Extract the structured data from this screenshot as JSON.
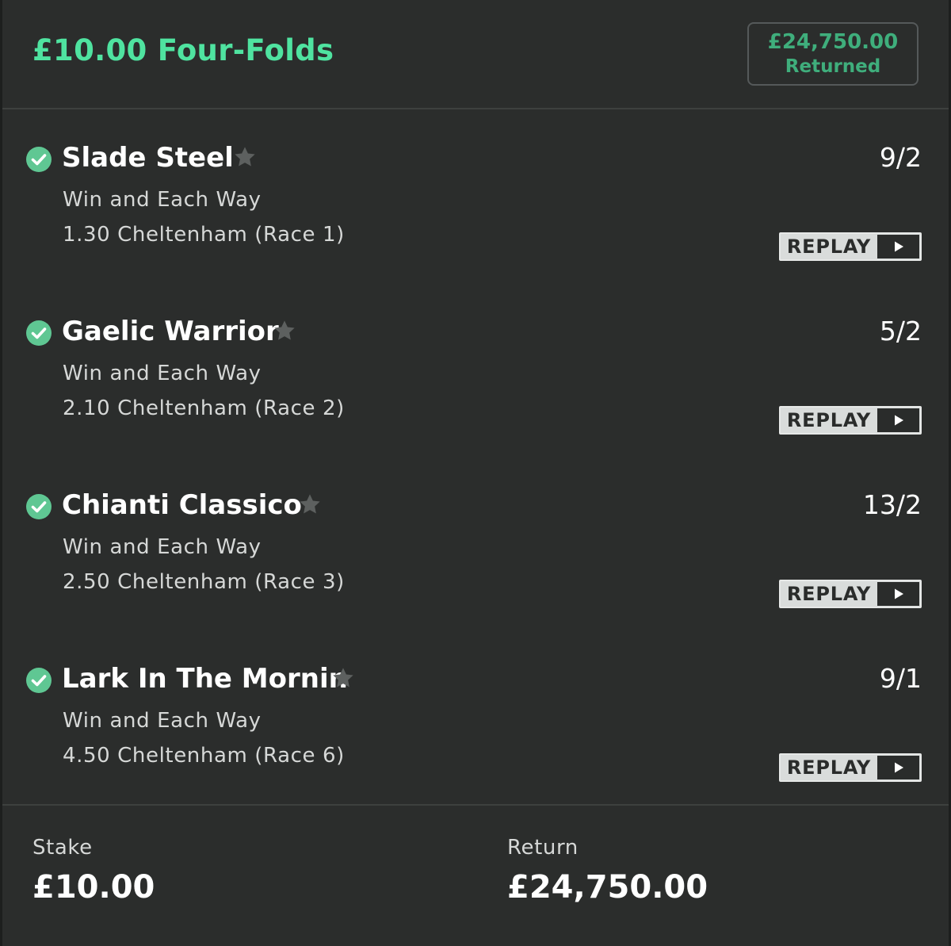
{
  "header": {
    "title": "£10.00 Four-Folds",
    "returned_amount": "£24,750.00",
    "returned_label": "Returned"
  },
  "selections": [
    {
      "horse": "Slade Steel",
      "odds": "9/2",
      "market": "Win and Each Way",
      "event": "1.30 Cheltenham (Race 1)",
      "replay_label": "REPLAY",
      "status_icon": "check-circle-icon",
      "favourite_icon": "star-icon"
    },
    {
      "horse": "Gaelic Warrior",
      "odds": "5/2",
      "market": "Win and Each Way",
      "event": "2.10 Cheltenham (Race 2)",
      "replay_label": "REPLAY",
      "status_icon": "check-circle-icon",
      "favourite_icon": "star-icon"
    },
    {
      "horse": "Chianti Classico",
      "odds": "13/2",
      "market": "Win and Each Way",
      "event": "2.50 Cheltenham (Race 3)",
      "replay_label": "REPLAY",
      "status_icon": "check-circle-icon",
      "favourite_icon": "star-icon"
    },
    {
      "horse": "Lark In The Mornin",
      "odds": "9/1",
      "market": "Win and Each Way",
      "event": "4.50 Cheltenham (Race 6)",
      "replay_label": "REPLAY",
      "status_icon": "check-circle-icon",
      "favourite_icon": "star-icon"
    }
  ],
  "footer": {
    "stake_label": "Stake",
    "stake_value": "£10.00",
    "return_label": "Return",
    "return_value": "£24,750.00"
  },
  "colors": {
    "accent_green": "#4fe3a0",
    "check_green": "#5fc793",
    "background": "#2b2d2c"
  }
}
